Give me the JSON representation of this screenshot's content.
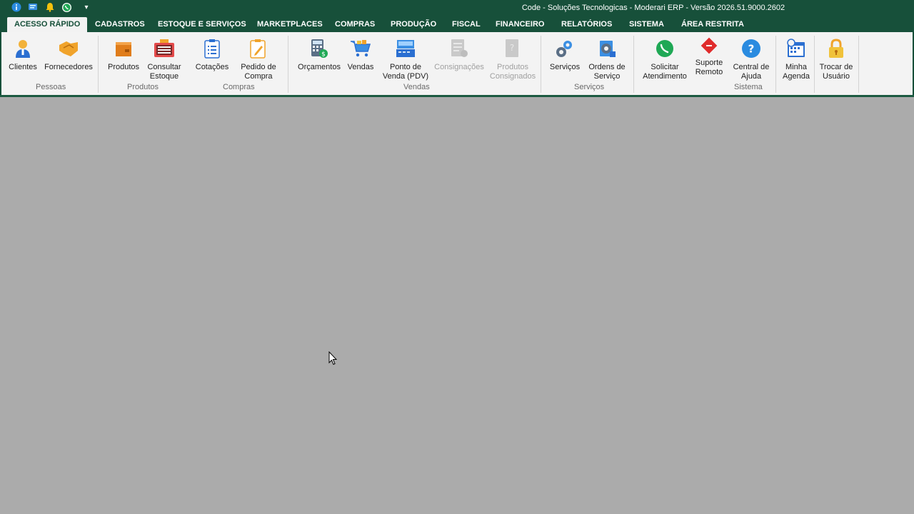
{
  "window": {
    "title": "Code - Soluções Tecnologicas - Moderari ERP - Versão 2026.51.9000.2602"
  },
  "quick_access": [
    {
      "icon": "info-icon"
    },
    {
      "icon": "message-icon"
    },
    {
      "icon": "bell-icon"
    },
    {
      "icon": "whatsapp-icon"
    },
    {
      "icon": "customize-dropdown-icon",
      "label": "▾"
    }
  ],
  "tabs": [
    {
      "label": "ACESSO RÁPIDO",
      "active": true
    },
    {
      "label": "CADASTROS"
    },
    {
      "label": "ESTOQUE E SERVIÇOS"
    },
    {
      "label": "MARKETPLACES"
    },
    {
      "label": "COMPRAS"
    },
    {
      "label": "PRODUÇÃO"
    },
    {
      "label": "FISCAL"
    },
    {
      "label": "FINANCEIRO"
    },
    {
      "label": "RELATÓRIOS"
    },
    {
      "label": "SISTEMA"
    },
    {
      "label": "ÁREA RESTRITA"
    }
  ],
  "ribbon": {
    "groups": {
      "pessoas": "Pessoas",
      "produtos": "Produtos",
      "compras": "Compras",
      "vendas": "Vendas",
      "servicos": "Serviços",
      "sistema": "Sistema"
    },
    "buttons": {
      "clientes": "Clientes",
      "fornecedores": "Fornecedores",
      "produtos": "Produtos",
      "consultar_estoque": "Consultar\nEstoque",
      "cotacoes": "Cotações",
      "pedido_compra": "Pedido de\nCompra",
      "orcamentos": "Orçamentos",
      "vendas": "Vendas",
      "pdv": "Ponto de\nVenda (PDV)",
      "consignacoes": "Consignações",
      "produtos_consignados": "Produtos\nConsignados",
      "servicos": "Serviços",
      "ordens_servico": "Ordens de\nServiço",
      "solicitar_atendimento": "Solicitar\nAtendimento",
      "suporte_remoto": "Suporte\nRemoto",
      "central_ajuda": "Central de\nAjuda",
      "minha_agenda": "Minha\nAgenda",
      "trocar_usuario": "Trocar de\nUsuário"
    }
  },
  "colors": {
    "brand": "#17503a",
    "workspace": "#ababab",
    "ribbon": "#f3f3f3"
  }
}
